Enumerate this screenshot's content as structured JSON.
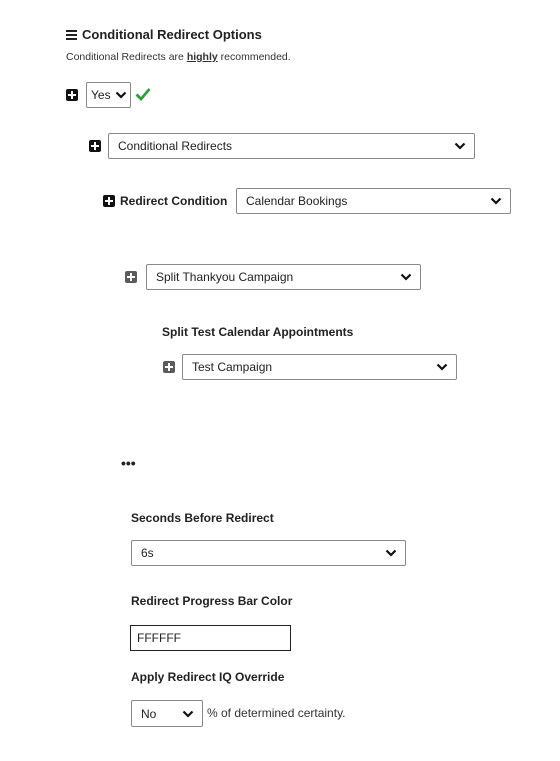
{
  "section": {
    "title": "Conditional Redirect Options",
    "icon": "hamburger-menu-icon",
    "subtitle_prefix": "Conditional Redirects are ",
    "subtitle_emphasis": "highly",
    "subtitle_suffix": " recommended."
  },
  "enable": {
    "value": "Yes",
    "status_icon": "checkmark-icon",
    "status_color": "#2e9e3a"
  },
  "redirect_type": {
    "value": "Conditional Redirects"
  },
  "redirect_condition": {
    "label": "Redirect Condition",
    "value": "Calendar Bookings"
  },
  "split_campaign": {
    "value": "Split Thankyou Campaign"
  },
  "split_test": {
    "label": "Split Test Calendar Appointments",
    "value": "Test Campaign"
  },
  "more": {
    "label": "•••"
  },
  "seconds_before_redirect": {
    "label": "Seconds Before Redirect",
    "value": "6s"
  },
  "progress_bar_color": {
    "label": "Redirect Progress Bar Color",
    "value": "FFFFFF"
  },
  "iq_override": {
    "label": "Apply Redirect IQ Override",
    "value": "No",
    "suffix": "% of determined certainty."
  },
  "colors": {
    "plus_primary": "#111111",
    "plus_nested": "#5b5b5b",
    "check_green": "#2e9e3a"
  }
}
